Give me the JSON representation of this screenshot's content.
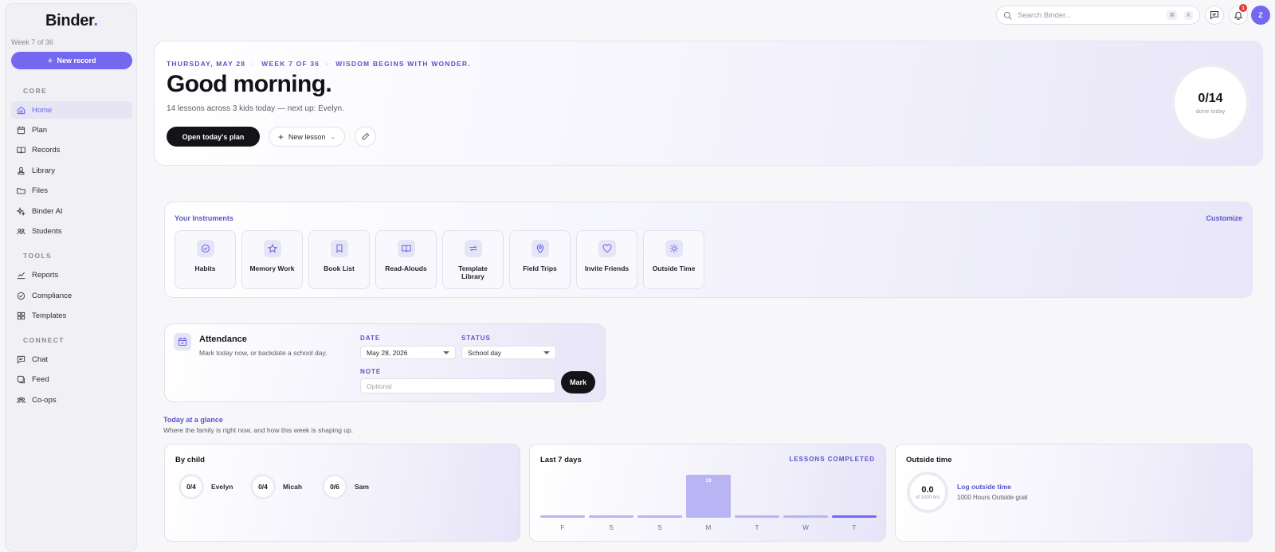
{
  "sidebar": {
    "logo": "Binder",
    "logo_dot": ".",
    "week": "Week 7 of 36",
    "new_record": "New record",
    "sections": {
      "core": "CORE",
      "tools": "TOOLS",
      "connect": "CONNECT"
    },
    "core_items": [
      {
        "label": "Home",
        "icon": "home-icon"
      },
      {
        "label": "Plan",
        "icon": "calendar-icon"
      },
      {
        "label": "Records",
        "icon": "book-icon"
      },
      {
        "label": "Library",
        "icon": "stack-icon"
      },
      {
        "label": "Files",
        "icon": "folder-icon"
      },
      {
        "label": "Binder AI",
        "icon": "sparkle-icon"
      },
      {
        "label": "Students",
        "icon": "users-icon"
      }
    ],
    "tools_items": [
      {
        "label": "Reports",
        "icon": "chart-icon"
      },
      {
        "label": "Compliance",
        "icon": "check-circle-icon"
      },
      {
        "label": "Templates",
        "icon": "grid-icon"
      }
    ],
    "connect_items": [
      {
        "label": "Chat",
        "icon": "chat-icon"
      },
      {
        "label": "Feed",
        "icon": "feed-icon"
      },
      {
        "label": "Co-ops",
        "icon": "group-icon"
      }
    ]
  },
  "topbar": {
    "search_placeholder": "Search Binder...",
    "kbd_cmd": "⌘",
    "kbd_k": "K",
    "notification_count": "1",
    "avatar_initial": "Z"
  },
  "hero": {
    "date": "THURSDAY, MAY 28",
    "week": "WEEK 7 OF 36",
    "motto": "WISDOM BEGINS WITH WONDER.",
    "sep": "·",
    "greeting": "Good morning.",
    "subline": "14 lessons across 3 kids today — next up: Evelyn.",
    "open_plan": "Open today's plan",
    "new_lesson": "New lesson",
    "progress": "0/14",
    "progress_label": "done today"
  },
  "instruments": {
    "title": "Your Instruments",
    "customize": "Customize",
    "items": [
      {
        "label": "Habits",
        "icon": "check-circle-icon"
      },
      {
        "label": "Memory Work",
        "icon": "star-icon"
      },
      {
        "label": "Book List",
        "icon": "bookmark-icon"
      },
      {
        "label": "Read-Alouds",
        "icon": "open-book-icon"
      },
      {
        "label": "Template Library",
        "icon": "repeat-icon"
      },
      {
        "label": "Field Trips",
        "icon": "map-pin-icon"
      },
      {
        "label": "Invite Friends",
        "icon": "heart-icon"
      },
      {
        "label": "Outside Time",
        "icon": "sun-icon"
      }
    ]
  },
  "attendance": {
    "title": "Attendance",
    "subtitle": "Mark today now, or backdate a school day.",
    "date_label": "DATE",
    "date_value": "May 28, 2026",
    "status_label": "STATUS",
    "status_value": "School day",
    "note_label": "NOTE",
    "note_placeholder": "Optional",
    "mark": "Mark"
  },
  "glance": {
    "title": "Today at a glance",
    "subtitle": "Where the family is right now, and how this week is shaping up.",
    "by_child": {
      "title": "By child",
      "kids": [
        {
          "name": "Evelyn",
          "progress": "0/4"
        },
        {
          "name": "Micah",
          "progress": "0/4"
        },
        {
          "name": "Sam",
          "progress": "0/6"
        }
      ]
    },
    "last7": {
      "title": "Last 7 days",
      "legend": "LESSONS COMPLETED"
    },
    "outside": {
      "title": "Outside time",
      "value": "0.0",
      "of": "of 1000 hrs",
      "link": "Log outside time",
      "goal": "1000 Hours Outside goal"
    }
  },
  "chart_data": {
    "type": "bar",
    "categories": [
      "F",
      "S",
      "S",
      "M",
      "T",
      "W",
      "T"
    ],
    "values": [
      0,
      0,
      0,
      19,
      0,
      0,
      0
    ],
    "highlight_index": 6,
    "title": "Last 7 days",
    "legend": "LESSONS COMPLETED",
    "colors": {
      "bar": "#b9b4f3",
      "today": "#7468f0"
    }
  }
}
